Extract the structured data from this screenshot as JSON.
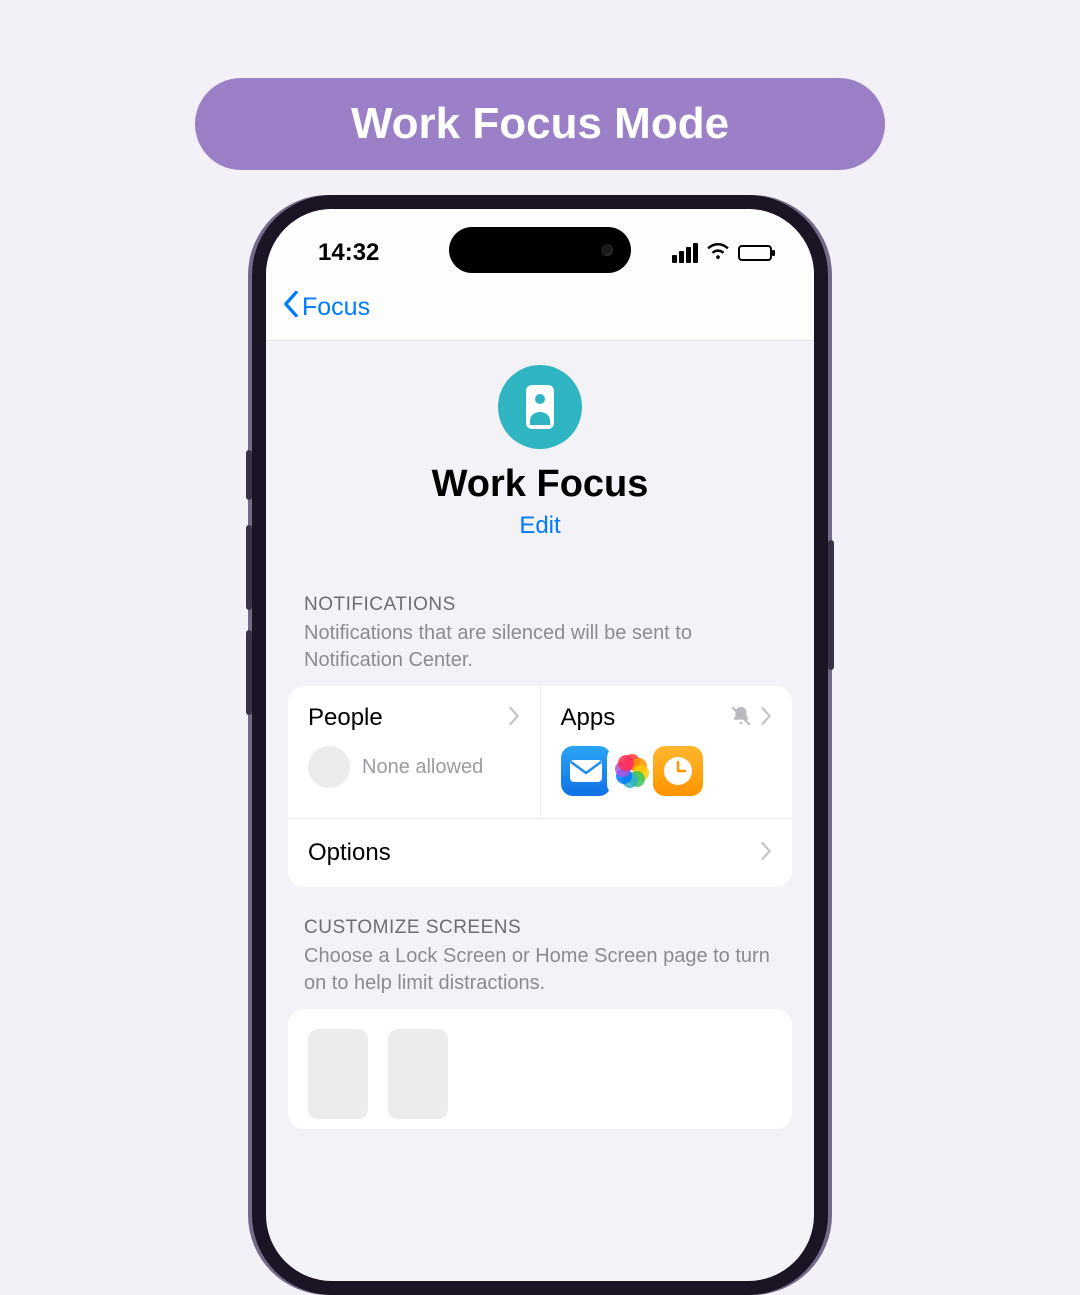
{
  "banner": {
    "title": "Work Focus Mode"
  },
  "statusbar": {
    "time": "14:32"
  },
  "nav": {
    "back_label": "Focus"
  },
  "hero": {
    "title": "Work Focus",
    "edit_label": "Edit"
  },
  "notifications": {
    "header": "NOTIFICATIONS",
    "subtitle": "Notifications that are silenced will be sent to Notification Center.",
    "people": {
      "title": "People",
      "status": "None allowed"
    },
    "apps": {
      "title": "Apps"
    },
    "options": "Options"
  },
  "customize": {
    "header": "CUSTOMIZE SCREENS",
    "subtitle": "Choose a Lock Screen or Home Screen page to turn on to help limit distractions."
  }
}
